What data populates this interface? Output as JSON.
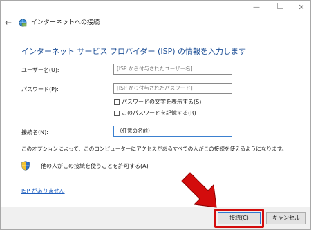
{
  "window": {
    "title": "インターネットへの接続",
    "heading": "インターネット サービス プロバイダー (ISP) の情報を入力します"
  },
  "form": {
    "username_label": "ユーザー名(U):",
    "username_placeholder": "[ISP から付与されたユーザー名]",
    "password_label": "パスワード(P):",
    "password_placeholder": "[ISP から付与されたパスワード]",
    "show_password_label": "パスワードの文字を表示する(S)",
    "remember_password_label": "このパスワードを記憶する(R)",
    "connection_name_label": "接続名(N):",
    "connection_name_value": "（任意の名前）"
  },
  "info_text": "このオプションによって、このコンピューターにアクセスがあるすべての人がこの接続を使えるようになります。",
  "allow_others_label": "他の人がこの接続を使うことを許可する(A)",
  "no_isp_link": "ISP がありません",
  "buttons": {
    "connect": "接続(C)",
    "cancel": "キャンセル"
  },
  "titlebar": {
    "close_glyph": "✕",
    "minimize_glyph": "—"
  },
  "colors": {
    "heading": "#1c4e96",
    "link": "#1f5fbf",
    "highlight": "#d30c0c"
  }
}
